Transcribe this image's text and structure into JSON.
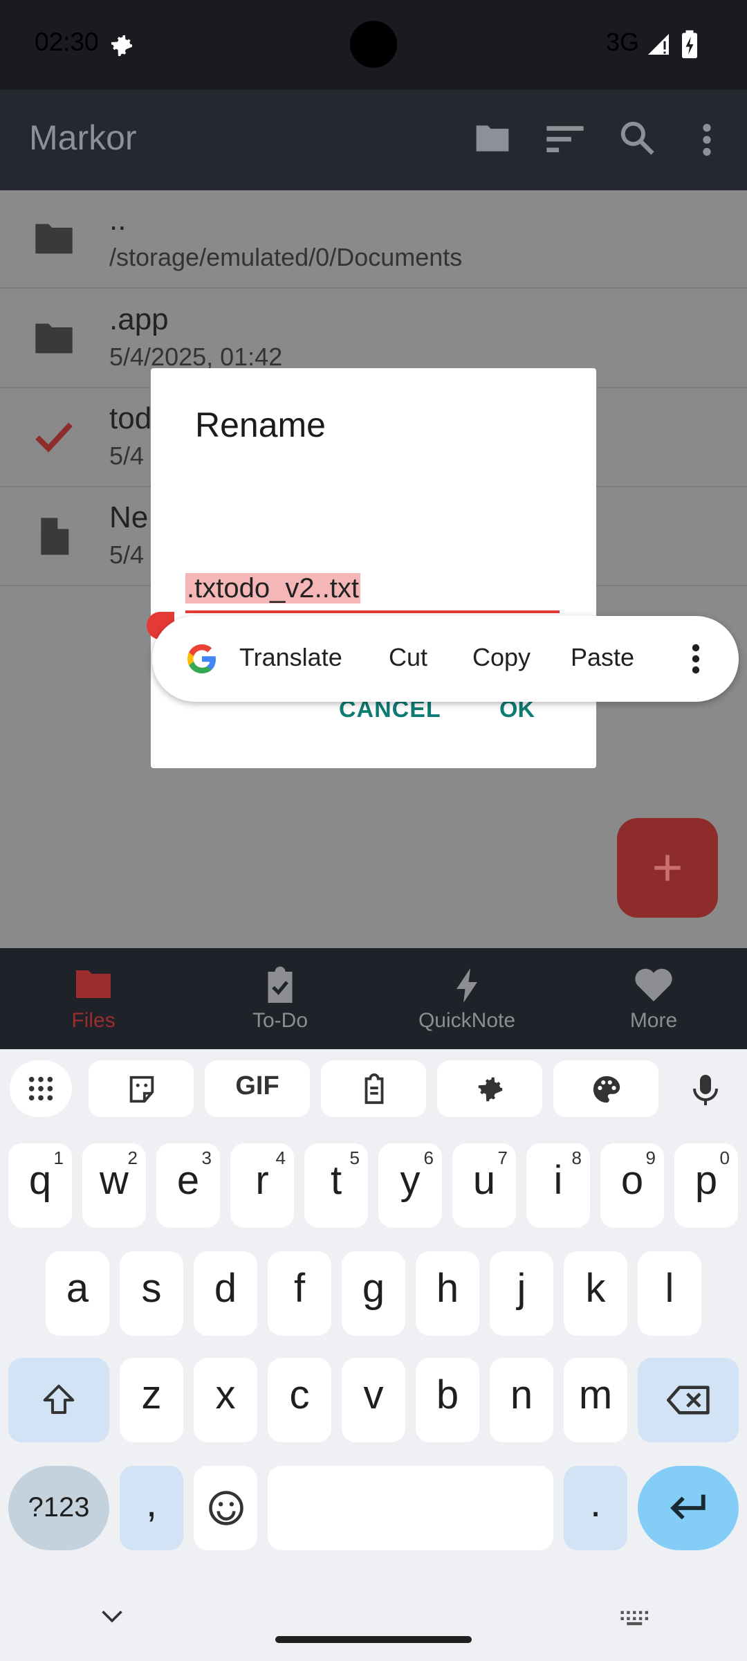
{
  "status": {
    "time": "02:30",
    "network": "3G"
  },
  "app": {
    "title": "Markor"
  },
  "files": [
    {
      "name": "..",
      "sub": "/storage/emulated/0/Documents",
      "icon": "folder-icon"
    },
    {
      "name": ".app",
      "sub": "5/4/2025, 01:42",
      "icon": "folder-icon"
    },
    {
      "name": "tod",
      "sub": "5/4",
      "icon": "check-icon"
    },
    {
      "name": "Ne",
      "sub": "5/4",
      "icon": "file-icon"
    }
  ],
  "nav": [
    {
      "label": "Files",
      "icon": "folder-icon",
      "active": true
    },
    {
      "label": "To-Do",
      "icon": "clipboard-check-icon"
    },
    {
      "label": "QuickNote",
      "icon": "flash-icon"
    },
    {
      "label": "More",
      "icon": "heart-icon"
    }
  ],
  "dialog": {
    "title": "Rename",
    "input_value": ".txtodo_v2..txt",
    "cancel_label": "CANCEL",
    "ok_label": "OK"
  },
  "selection_toolbar": {
    "items": [
      "Translate",
      "Cut",
      "Copy",
      "Paste"
    ]
  },
  "keyboard": {
    "row1": [
      {
        "k": "q",
        "n": "1"
      },
      {
        "k": "w",
        "n": "2"
      },
      {
        "k": "e",
        "n": "3"
      },
      {
        "k": "r",
        "n": "4"
      },
      {
        "k": "t",
        "n": "5"
      },
      {
        "k": "y",
        "n": "6"
      },
      {
        "k": "u",
        "n": "7"
      },
      {
        "k": "i",
        "n": "8"
      },
      {
        "k": "o",
        "n": "9"
      },
      {
        "k": "p",
        "n": "0"
      }
    ],
    "row2": [
      "a",
      "s",
      "d",
      "f",
      "g",
      "h",
      "j",
      "k",
      "l"
    ],
    "row3": [
      "z",
      "x",
      "c",
      "v",
      "b",
      "n",
      "m"
    ],
    "symbols_label": "?123",
    "comma": ",",
    "period": "."
  },
  "colors": {
    "accent": "#e53935",
    "teal": "#0e7b73"
  }
}
